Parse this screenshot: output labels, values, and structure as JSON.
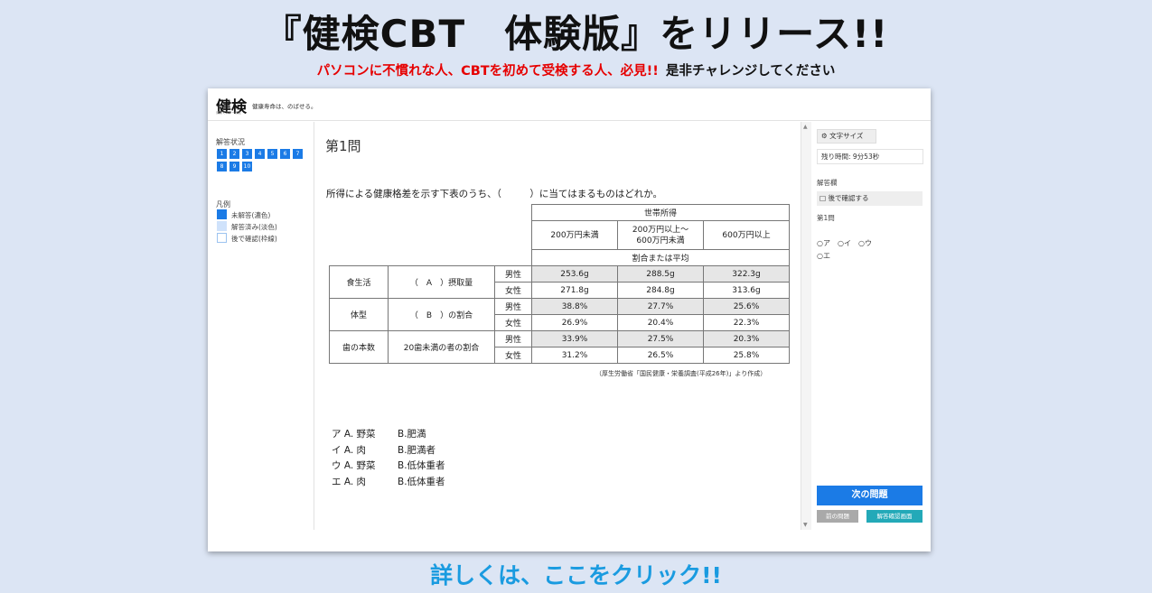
{
  "banner": {
    "headline": "『健検CBT　体験版』をリリース!!",
    "subline_red": "パソコンに不慣れな人、CBTを初めて受検する人、必見!!",
    "subline_black": "是非チャレンジしてください",
    "cta": "詳しくは、ここをクリック!!"
  },
  "app": {
    "logo": "健検",
    "logo_sub": "健康マスター検定",
    "tagline": "健康寿命は、のばせる。"
  },
  "left_panel": {
    "status_label": "解答状況",
    "question_buttons": [
      "1",
      "2",
      "3",
      "4",
      "5",
      "6",
      "7",
      "8",
      "9",
      "10"
    ],
    "legend_label": "凡例",
    "legend": [
      {
        "label": "未解答(濃色)",
        "color": "#1b7be6"
      },
      {
        "label": "解答済み(淡色)",
        "color": "#cfe2fb"
      },
      {
        "label": "後で確認(枠線)",
        "color": "#ffffff"
      }
    ]
  },
  "main": {
    "question_number": "第1問",
    "question_text": "所得による健康格差を示す下表のうち、（　　　）に当てはまるものはどれか。",
    "table": {
      "header_top": "世帯所得",
      "col_headers": [
        "200万円未満",
        "200万円以上～\n600万円未満",
        "600万円以上"
      ],
      "subheader": "割合または平均",
      "groups": [
        {
          "category": "食生活",
          "item": "（　A　）摂取量",
          "rows": [
            {
              "sex": "男性",
              "values": [
                "253.6g",
                "288.5g",
                "322.3g"
              ]
            },
            {
              "sex": "女性",
              "values": [
                "271.8g",
                "284.8g",
                "313.6g"
              ]
            }
          ]
        },
        {
          "category": "体型",
          "item": "（　B　）の割合",
          "rows": [
            {
              "sex": "男性",
              "values": [
                "38.8%",
                "27.7%",
                "25.6%"
              ]
            },
            {
              "sex": "女性",
              "values": [
                "26.9%",
                "20.4%",
                "22.3%"
              ]
            }
          ]
        },
        {
          "category": "歯の本数",
          "item": "20歯未満の者の割合",
          "rows": [
            {
              "sex": "男性",
              "values": [
                "33.9%",
                "27.5%",
                "20.3%"
              ]
            },
            {
              "sex": "女性",
              "values": [
                "31.2%",
                "26.5%",
                "25.8%"
              ]
            }
          ]
        }
      ],
      "source": "（厚生労働省「国民健康・栄養調査(平成26年)」より作成）"
    },
    "choices": [
      {
        "a": "ア A. 野菜",
        "b": "B.肥満"
      },
      {
        "a": "イ A. 肉",
        "b": "B.肥満者"
      },
      {
        "a": "ウ A. 野菜",
        "b": "B.低体重者"
      },
      {
        "a": "エ A. 肉",
        "b": "B.低体重者"
      }
    ]
  },
  "right_panel": {
    "font_size_label": "文字サイズ",
    "font_icon": "gear-icon",
    "timer": "残り時間: 9分53秒",
    "answer_label": "解答欄",
    "check_later": "□ 後で確認する",
    "question_label": "第1問",
    "options_row1": "○ア　○イ　○ウ",
    "options_row2": "○エ",
    "next_button": "次の問題",
    "prev_button": "前の問題",
    "review_button": "解答確認画面"
  }
}
